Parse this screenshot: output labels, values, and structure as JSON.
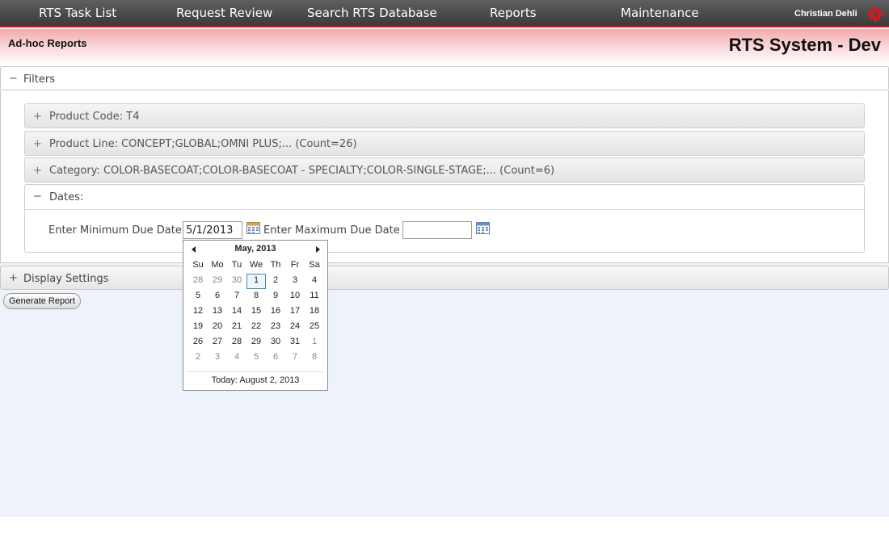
{
  "nav": {
    "items": [
      "RTS Task List",
      "Request Review",
      "Search RTS Database",
      "Reports",
      "Maintenance"
    ],
    "user": "Christian Dehli",
    "settings_icon": "gear-icon",
    "accent_color": "#d8161d"
  },
  "header": {
    "subtitle": "Ad-hoc Reports",
    "system_title": "RTS System - Dev"
  },
  "filters": {
    "label": "Filters",
    "toggle": "−",
    "sections": [
      {
        "toggle": "+",
        "label": "Product Code: T4"
      },
      {
        "toggle": "+",
        "label": "Product Line: CONCEPT;GLOBAL;OMNI PLUS;... (Count=26)"
      },
      {
        "toggle": "+",
        "label": "Category: COLOR-BASECOAT;COLOR-BASECOAT - SPECIALTY;COLOR-SINGLE-STAGE;... (Count=6)"
      }
    ],
    "dates": {
      "toggle": "−",
      "label": "Dates:",
      "min_label": "Enter Minimum Due Date",
      "min_value": "5/1/2013",
      "max_label": "Enter Maximum Due Date",
      "max_value": ""
    }
  },
  "display_settings": {
    "toggle": "+",
    "label": "Display Settings"
  },
  "generate_button": "Generate Report",
  "calendar": {
    "title": "May, 2013",
    "days_of_week": [
      "Su",
      "Mo",
      "Tu",
      "We",
      "Th",
      "Fr",
      "Sa"
    ],
    "weeks": [
      [
        "28",
        "29",
        "30",
        "1",
        "2",
        "3",
        "4"
      ],
      [
        "5",
        "6",
        "7",
        "8",
        "9",
        "10",
        "11"
      ],
      [
        "12",
        "13",
        "14",
        "15",
        "16",
        "17",
        "18"
      ],
      [
        "19",
        "20",
        "21",
        "22",
        "23",
        "24",
        "25"
      ],
      [
        "26",
        "27",
        "28",
        "29",
        "30",
        "31",
        "1"
      ],
      [
        "2",
        "3",
        "4",
        "5",
        "6",
        "7",
        "8"
      ]
    ],
    "selected_day": "1",
    "today_text": "Today: August 2, 2013"
  }
}
